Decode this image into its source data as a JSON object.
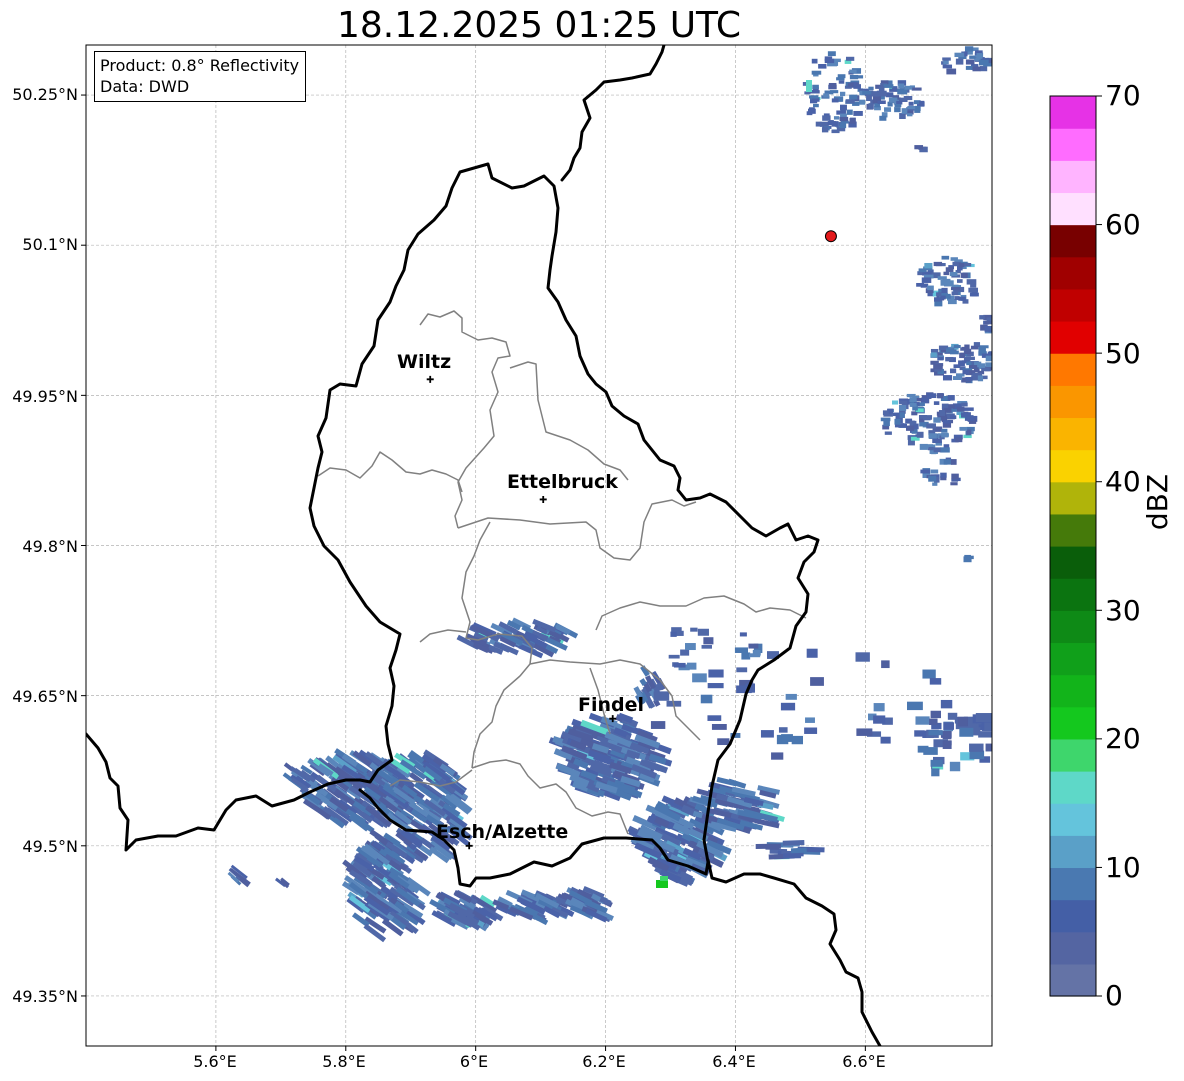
{
  "title": "18.12.2025 01:25 UTC",
  "info": {
    "product": "Product: 0.8° Reflectivity",
    "source": "Data: DWD"
  },
  "lat_ticks": [
    "50.25°N",
    "50.1°N",
    "49.95°N",
    "49.8°N",
    "49.65°N",
    "49.5°N",
    "49.35°N"
  ],
  "lon_ticks": [
    "5.6°E",
    "5.8°E",
    "6°E",
    "6.2°E",
    "6.4°E",
    "6.6°E"
  ],
  "cities": [
    {
      "name": "Wiltz",
      "lon": 5.93,
      "lat": 49.966
    },
    {
      "name": "Ettelbruck",
      "lon": 6.104,
      "lat": 49.846
    },
    {
      "name": "Findel",
      "lon": 6.211,
      "lat": 49.627
    },
    {
      "name": "Esch/Alzette",
      "lon": 5.99,
      "lat": 49.5
    }
  ],
  "marker": {
    "lon": 6.547,
    "lat": 50.109,
    "color": "#e31a1c"
  },
  "map_extent": {
    "lon": [
      5.4,
      6.795
    ],
    "lat": [
      49.3,
      50.3
    ]
  },
  "colorbar": {
    "label": "dBZ",
    "range": [
      0,
      70
    ],
    "ticks": [
      "0",
      "10",
      "20",
      "30",
      "40",
      "50",
      "60",
      "70"
    ],
    "colors": [
      "#6473a6",
      "#5465a2",
      "#445fa6",
      "#4a79b1",
      "#5aa0c8",
      "#64c4dc",
      "#5ed8c8",
      "#3ed66c",
      "#14c81e",
      "#12b41a",
      "#10a01a",
      "#0e8a16",
      "#0b7410",
      "#0a5e0a",
      "#457a0a",
      "#b0b40a",
      "#fad200",
      "#fab400",
      "#fa9600",
      "#ff7800",
      "#e10000",
      "#c00000",
      "#a00000",
      "#780000",
      "#ffe0ff",
      "#ffb4ff",
      "#ff6cff",
      "#e632e6"
    ]
  }
}
